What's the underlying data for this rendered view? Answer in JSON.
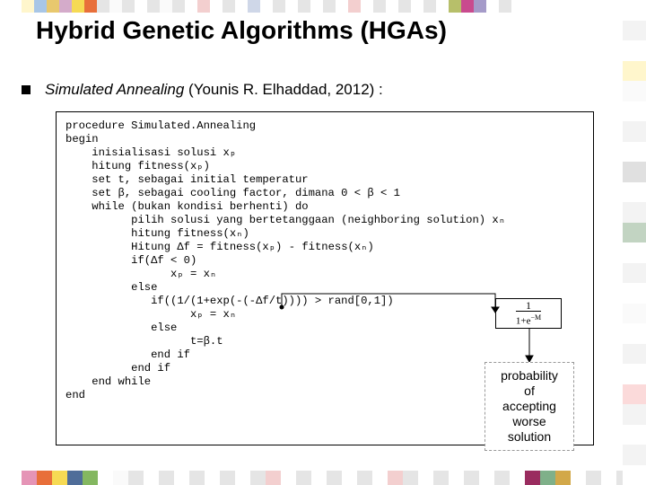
{
  "title": "Hybrid Genetic Algorithms (HGAs)",
  "subtitle_italic": "Simulated Annealing",
  "subtitle_rest": " (Younis R. Elhaddad, 2012) :",
  "code": "procedure Simulated.Annealing\nbegin\n    inisialisasi solusi xₚ\n    hitung fitness(xₚ)\n    set t, sebagai initial temperatur\n    set β, sebagai cooling factor, dimana 0 < β < 1\n    while (bukan kondisi berhenti) do\n          pilih solusi yang bertetanggaan (neighboring solution) xₙ\n          hitung fitness(xₙ)\n          Hitung Δf = fitness(xₚ) - fitness(xₙ)\n          if(Δf < 0)\n                xₚ = xₙ\n          else\n             if((1/(1+exp(-(-Δf/t)))) > rand[0,1])\n                   xₚ = xₙ\n             else\n                   t=β.t\n             end if\n          end if\n    end while\nend",
  "formula_top": "1",
  "formula_bot": "1+e",
  "formula_exp": "−M",
  "note": "probability\nof\naccepting\nworse\nsolution",
  "deco_top": [
    "#fff6cc",
    "#a8c6e6",
    "#e8c86e",
    "#d4abca",
    "#f6da54",
    "#e86f3a",
    "#e5e5e5",
    "#fafafa",
    "#e5e5e5",
    "#fff",
    "#e5e5e5",
    "#fafafa",
    "#e5e5e5",
    "#fff",
    "#f3cfcf",
    "#fff",
    "#e5e5e5",
    "#fff",
    "#cfd7e8",
    "#fff",
    "#e5e5e5",
    "#fff",
    "#e5e5e5",
    "#fff",
    "#e5e5e5",
    "#fff",
    "#f3cfcf",
    "#fff",
    "#e5e5e5",
    "#fff",
    "#e5e5e5",
    "#fff",
    "#e5e5e5",
    "#fff",
    "#b7bf6a",
    "#c94b8e",
    "#a59bc9",
    "#fff",
    "#e5e5e5",
    "#fff"
  ],
  "deco_bot": [
    "#e594b6",
    "#e86f3a",
    "#f6da54",
    "#4f6d99",
    "#84b760",
    "#fff",
    "#fafafa",
    "#e5e5e5",
    "#fff",
    "#e5e5e5",
    "#fff",
    "#e5e5e5",
    "#fff",
    "#e5e5e5",
    "#fff",
    "#e5e5e5",
    "#f3cfcf",
    "#fff",
    "#e5e5e5",
    "#fff",
    "#e5e5e5",
    "#fff",
    "#e5e5e5",
    "#fff",
    "#f3cfcf",
    "#e5e5e5",
    "#fff",
    "#e5e5e5",
    "#fff",
    "#e5e5e5",
    "#fff",
    "#e5e5e5",
    "#fff",
    "#9a2c5f",
    "#7fb089",
    "#d2a849",
    "#fff",
    "#e5e5e5",
    "#fff",
    "#e5e5e5"
  ],
  "deco_side": [
    "#fff",
    "#f3f3f3",
    "#fff",
    "#fff6cc",
    "#fafafa",
    "#fff",
    "#f3f3f3",
    "#fff",
    "#e0e0e0",
    "#fff",
    "#f3f3f3",
    "#c2d4c2",
    "#fff",
    "#f3f3f3",
    "#fff",
    "#fafafa",
    "#fff",
    "#f3f3f3",
    "#fff",
    "#fbdada",
    "#f3f3f3",
    "#fff",
    "#f3f3f3",
    "#fff"
  ]
}
